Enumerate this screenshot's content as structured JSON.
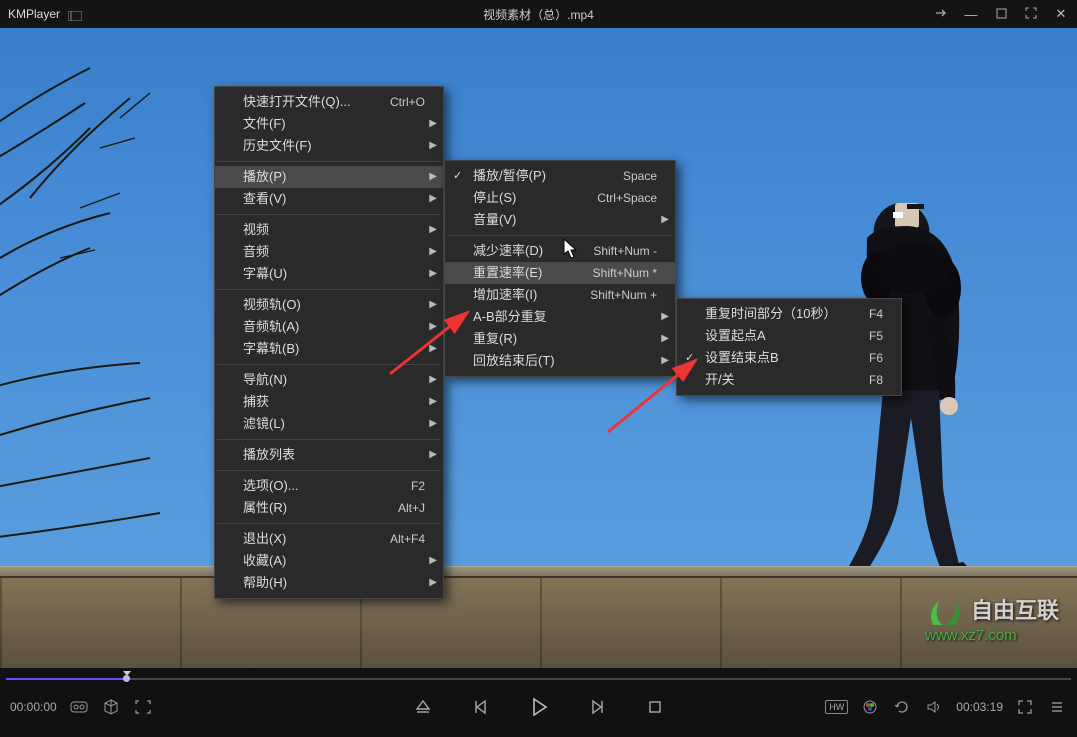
{
  "title_bar": {
    "app": "KMPlayer",
    "file_title": "视频素材（总）.mp4"
  },
  "menu1": {
    "items": [
      {
        "label": "快速打开文件(Q)...",
        "accel": "Ctrl+O"
      },
      {
        "label": "文件(F)",
        "arrow": true
      },
      {
        "label": "历史文件(F)",
        "arrow": true
      },
      {
        "sep": true
      },
      {
        "label": "播放(P)",
        "arrow": true,
        "highlight": true
      },
      {
        "label": "查看(V)",
        "arrow": true
      },
      {
        "sep": true
      },
      {
        "label": "视频",
        "arrow": true
      },
      {
        "label": "音频",
        "arrow": true
      },
      {
        "label": "字幕(U)",
        "arrow": true
      },
      {
        "sep": true
      },
      {
        "label": "视频轨(O)",
        "arrow": true
      },
      {
        "label": "音频轨(A)",
        "arrow": true
      },
      {
        "label": "字幕轨(B)",
        "arrow": true
      },
      {
        "sep": true
      },
      {
        "label": "导航(N)",
        "arrow": true
      },
      {
        "label": "捕获",
        "arrow": true
      },
      {
        "label": "滤镜(L)",
        "arrow": true
      },
      {
        "sep": true
      },
      {
        "label": "播放列表",
        "arrow": true
      },
      {
        "sep": true
      },
      {
        "label": "选项(O)...",
        "accel": "F2"
      },
      {
        "label": "属性(R)",
        "accel": "Alt+J"
      },
      {
        "sep": true
      },
      {
        "label": "退出(X)",
        "accel": "Alt+F4"
      },
      {
        "label": "收藏(A)",
        "arrow": true
      },
      {
        "label": "帮助(H)",
        "arrow": true
      }
    ]
  },
  "menu2": {
    "items": [
      {
        "label": "播放/暂停(P)",
        "accel": "Space",
        "check": true
      },
      {
        "label": "停止(S)",
        "accel": "Ctrl+Space"
      },
      {
        "label": "音量(V)",
        "arrow": true
      },
      {
        "sep": true
      },
      {
        "label": "减少速率(D)",
        "accel": "Shift+Num -"
      },
      {
        "label": "重置速率(E)",
        "accel": "Shift+Num *",
        "highlight": true
      },
      {
        "label": "增加速率(I)",
        "accel": "Shift+Num +"
      },
      {
        "label": "A-B部分重复",
        "arrow": true
      },
      {
        "label": "重复(R)",
        "arrow": true
      },
      {
        "label": "回放结束后(T)",
        "arrow": true
      }
    ]
  },
  "menu3": {
    "items": [
      {
        "label": "重复时间部分（10秒）",
        "accel": "F4"
      },
      {
        "label": "设置起点A",
        "accel": "F5"
      },
      {
        "label": "设置结束点B",
        "accel": "F6",
        "check": true
      },
      {
        "label": "开/关",
        "accel": "F8"
      }
    ]
  },
  "controls": {
    "time": "00:00:00",
    "total": "00:03:19",
    "hw": "HW"
  },
  "watermark": {
    "brand": "自由互联",
    "url": "www.xz7.com"
  }
}
